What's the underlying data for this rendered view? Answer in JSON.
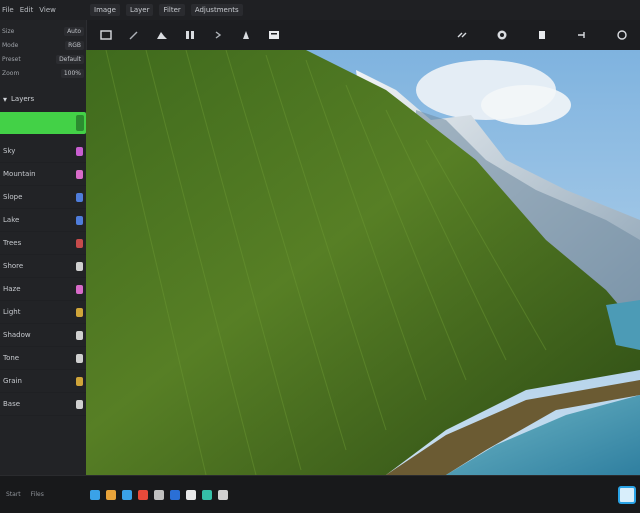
{
  "menubar": {
    "items": [
      "File",
      "Edit",
      "View"
    ],
    "tabs": [
      "Image",
      "Layer",
      "Filter",
      "Adjustments"
    ]
  },
  "toolbar": {
    "tools": [
      "crop-icon",
      "brush-icon",
      "mountain-icon",
      "text-icon",
      "pointer-icon",
      "hand-icon",
      "layers-icon"
    ],
    "right_tools": [
      "link-icon",
      "circle-icon",
      "shape-icon",
      "eyedropper-icon",
      "settings-icon"
    ]
  },
  "sidebar": {
    "header_rows": [
      {
        "label": "Size",
        "value": "Auto"
      },
      {
        "label": "Mode",
        "value": "RGB"
      },
      {
        "label": "Preset",
        "value": "Default"
      },
      {
        "label": "Zoom",
        "value": "100%"
      }
    ],
    "section_title": "Layers",
    "items": [
      {
        "label": "Sky",
        "accent": "#c95fd1"
      },
      {
        "label": "Mountain",
        "accent": "#d96bc9"
      },
      {
        "label": "Slope",
        "accent": "#4f7ddb"
      },
      {
        "label": "Lake",
        "accent": "#4f7ddb"
      },
      {
        "label": "Trees",
        "accent": "#c64b4b"
      },
      {
        "label": "Shore",
        "accent": "#d0d0d0"
      },
      {
        "label": "Haze",
        "accent": "#d96bc9"
      },
      {
        "label": "Light",
        "accent": "#d0a53a"
      },
      {
        "label": "Shadow",
        "accent": "#d0d0d0"
      },
      {
        "label": "Tone",
        "accent": "#d0d0d0"
      },
      {
        "label": "Grain",
        "accent": "#d0a53a"
      },
      {
        "label": "Base",
        "accent": "#d0d0d0"
      }
    ]
  },
  "taskbar": {
    "labels": [
      "Start",
      "Files"
    ],
    "app_colors": [
      "#3aa2e8",
      "#e8a33a",
      "#3aa2e8",
      "#e84a3a",
      "#c0c0c0",
      "#2a6fd6",
      "#e8e8e8",
      "#35c0a8",
      "#d0d0d0"
    ]
  },
  "colors": {
    "accent": "#43d147",
    "background": "#1b1c1e"
  }
}
